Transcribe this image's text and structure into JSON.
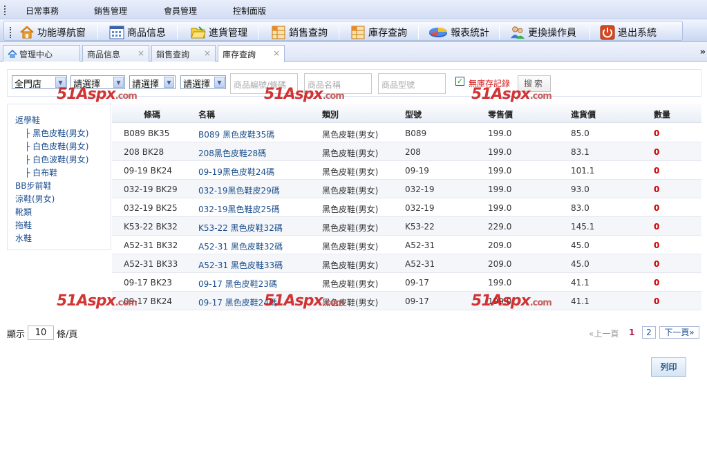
{
  "menu": [
    "日常事務",
    "銷售管理",
    "會員管理",
    "控制面版"
  ],
  "toolbar": [
    {
      "label": "功能導航窗",
      "icon": "home-icon"
    },
    {
      "label": "商品信息",
      "icon": "grid-icon"
    },
    {
      "label": "進貨管理",
      "icon": "folder-icon"
    },
    {
      "label": "銷售查詢",
      "icon": "table-icon"
    },
    {
      "label": "庫存查詢",
      "icon": "table-icon"
    },
    {
      "label": "報表統計",
      "icon": "pie-chart-icon"
    },
    {
      "label": "更換操作員",
      "icon": "users-icon"
    },
    {
      "label": "退出系統",
      "icon": "power-icon"
    }
  ],
  "tabs": [
    {
      "label": "管理中心",
      "closable": false,
      "active": false
    },
    {
      "label": "商品信息",
      "closable": true,
      "active": false
    },
    {
      "label": "銷售查詢",
      "closable": true,
      "active": false
    },
    {
      "label": "庫存查詢",
      "closable": true,
      "active": true
    }
  ],
  "tab_close_glyph": "×",
  "tab_scroll_glyph": "»",
  "filters": {
    "store": "全門店",
    "select1": "請選擇",
    "select2": "請選擇",
    "select3": "請選擇",
    "code_placeholder": "商品編號/條碼",
    "name_placeholder": "商品名稱",
    "model_placeholder": "商品型號",
    "no_stock_label": "無庫存記錄",
    "no_stock_checked": true,
    "search_label": "搜索"
  },
  "tree": [
    {
      "label": "返學鞋",
      "level": 0
    },
    {
      "label": "黑色皮鞋(男女)",
      "level": 1
    },
    {
      "label": "白色皮鞋(男女)",
      "level": 1
    },
    {
      "label": "白色波鞋(男女)",
      "level": 1
    },
    {
      "label": "白布鞋",
      "level": 1
    },
    {
      "label": "BB步前鞋",
      "level": 0
    },
    {
      "label": "涼鞋(男女)",
      "level": 0
    },
    {
      "label": "靴類",
      "level": 0
    },
    {
      "label": "拖鞋",
      "level": 0
    },
    {
      "label": "水鞋",
      "level": 0
    }
  ],
  "tree_branch_glyph": "├",
  "columns": [
    "條碼",
    "名稱",
    "類別",
    "型號",
    "零售價",
    "進貨價",
    "數量"
  ],
  "rows": [
    [
      "B089 BK35",
      "B089 黑色皮鞋35碼",
      "黑色皮鞋(男女)",
      "B089",
      "199.0",
      "85.0",
      "0"
    ],
    [
      "208 BK28",
      "208黑色皮鞋28碼",
      "黑色皮鞋(男女)",
      "208",
      "199.0",
      "83.1",
      "0"
    ],
    [
      "09-19 BK24",
      "09-19黑色皮鞋24碼",
      "黑色皮鞋(男女)",
      "09-19",
      "199.0",
      "101.1",
      "0"
    ],
    [
      "032-19 BK29",
      "032-19黑色鞋皮29碼",
      "黑色皮鞋(男女)",
      "032-19",
      "199.0",
      "93.0",
      "0"
    ],
    [
      "032-19 BK25",
      "032-19黑色鞋皮25碼",
      "黑色皮鞋(男女)",
      "032-19",
      "199.0",
      "83.0",
      "0"
    ],
    [
      "K53-22 BK32",
      "K53-22 黑色皮鞋32碼",
      "黑色皮鞋(男女)",
      "K53-22",
      "229.0",
      "145.1",
      "0"
    ],
    [
      "A52-31 BK32",
      "A52-31 黑色皮鞋32碼",
      "黑色皮鞋(男女)",
      "A52-31",
      "209.0",
      "45.0",
      "0"
    ],
    [
      "A52-31 BK33",
      "A52-31 黑色皮鞋33碼",
      "黑色皮鞋(男女)",
      "A52-31",
      "209.0",
      "45.0",
      "0"
    ],
    [
      "09-17 BK23",
      "09-17 黑色皮鞋23碼",
      "黑色皮鞋(男女)",
      "09-17",
      "199.0",
      "41.1",
      "0"
    ],
    [
      "09-17 BK24",
      "09-17 黑色皮鞋24碼",
      "黑色皮鞋(男女)",
      "09-17",
      "199.0",
      "41.1",
      "0"
    ]
  ],
  "pagination": {
    "show_label": "顯示",
    "page_size": "10",
    "unit_label": "條/頁",
    "prev": "«上一頁",
    "current": "1",
    "page2": "2",
    "next": "下一頁»"
  },
  "print_label": "列印",
  "watermark": {
    "main": "51Aspx",
    "suffix": ".com"
  },
  "colors": {
    "accent": "#1c4f8e",
    "qty_zero": "#d10000",
    "watermark": "#cc1111"
  }
}
